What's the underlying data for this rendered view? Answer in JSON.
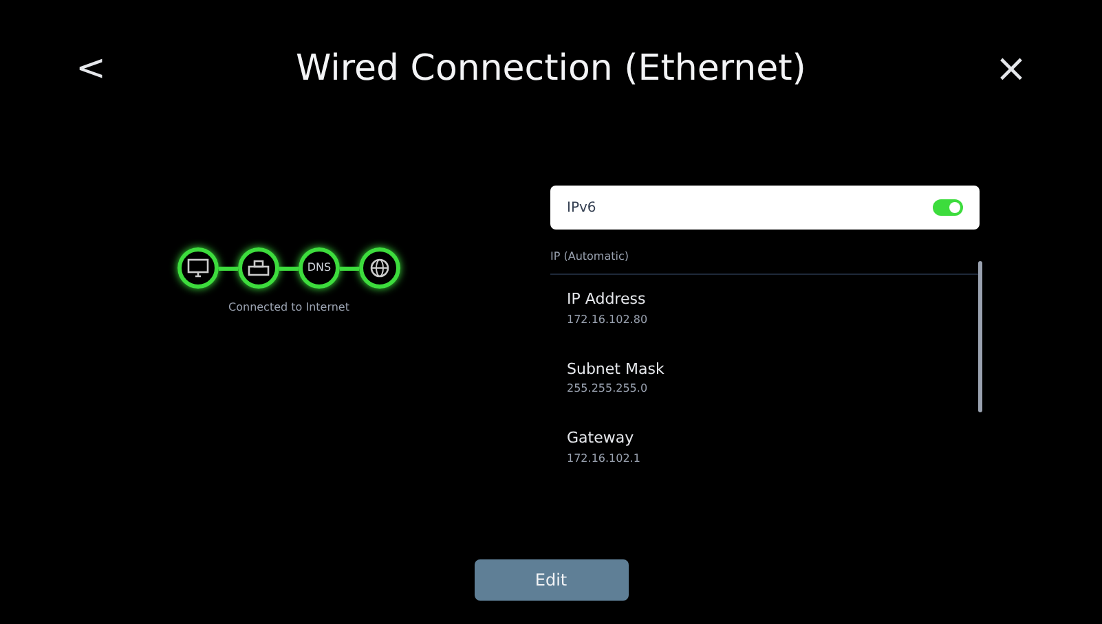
{
  "header": {
    "back": "<",
    "title": "Wired Connection (Ethernet)",
    "close": "×"
  },
  "diagram": {
    "nodes": [
      {
        "kind": "tv"
      },
      {
        "kind": "router"
      },
      {
        "kind": "dns",
        "label": "DNS"
      },
      {
        "kind": "globe"
      }
    ],
    "status": "Connected to Internet"
  },
  "ipv6": {
    "label": "IPv6",
    "on": true
  },
  "section": "IP (Automatic)",
  "fields": [
    {
      "label": "IP Address",
      "value": "172.16.102.80"
    },
    {
      "label": "Subnet Mask",
      "value": "255.255.255.0"
    },
    {
      "label": "Gateway",
      "value": "172.16.102.1"
    }
  ],
  "edit_button": "Edit"
}
